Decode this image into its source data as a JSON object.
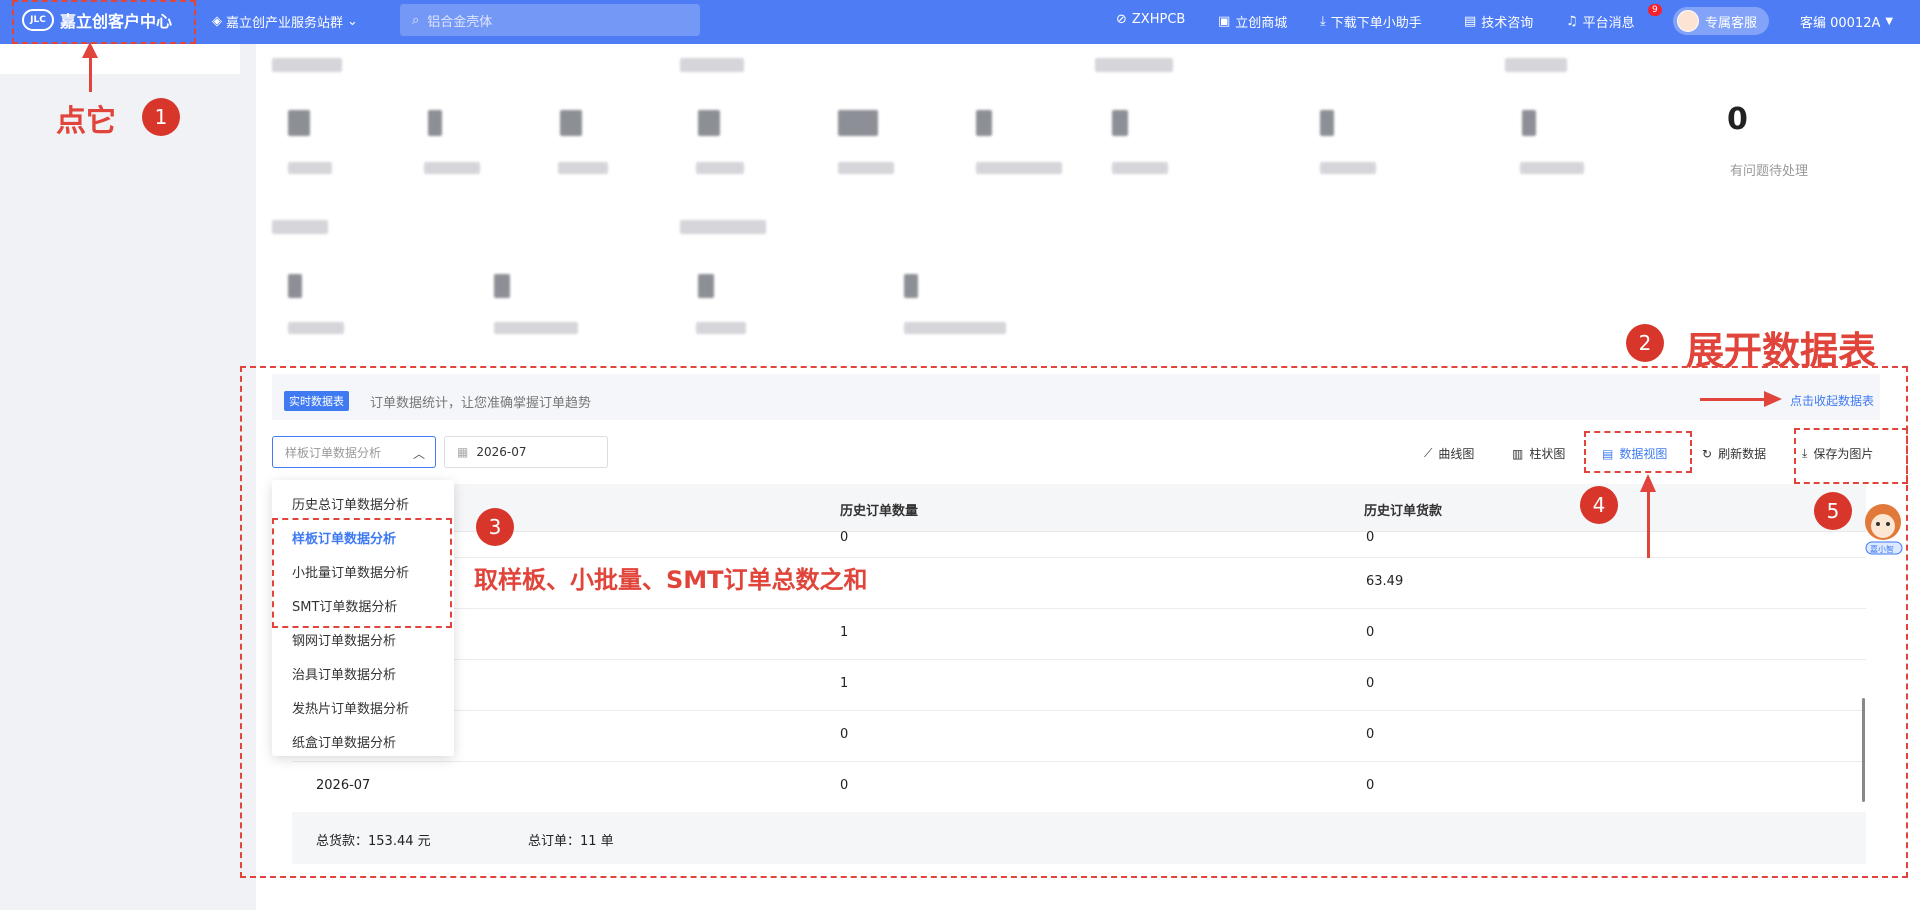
{
  "header": {
    "logo_text": "JLC",
    "brand": "嘉立创客户中心",
    "group": "嘉立创产业服务站群",
    "search_placeholder": "铝合金壳体",
    "nav": [
      "ZXHPCB",
      "立创商城",
      "下载下单小助手",
      "技术咨询",
      "平台消息"
    ],
    "message_count": "9",
    "service": "专属客服",
    "account": "客编 00012A"
  },
  "stats": {
    "problem_count": "0",
    "problem_label": "有问题待处理"
  },
  "data_table": {
    "badge": "实时数据表",
    "description": "订单数据统计，让您准确掌握订单趋势",
    "collapse_link": "点击收起数据表",
    "select_placeholder": "样板订单数据分析",
    "date_value": "2026-07",
    "toolbar": [
      "曲线图",
      "柱状图",
      "数据视图",
      "刷新数据",
      "保存为图片"
    ],
    "columns": [
      "历史订单数量",
      "历史订单货款"
    ],
    "rows": [
      {
        "month": "",
        "count": "0",
        "amount": "0"
      },
      {
        "month": "",
        "count": "",
        "amount": "63.49"
      },
      {
        "month": "",
        "count": "1",
        "amount": "0"
      },
      {
        "month": "",
        "count": "1",
        "amount": "0"
      },
      {
        "month": "",
        "count": "0",
        "amount": "0"
      },
      {
        "month": "2026-07",
        "count": "0",
        "amount": "0"
      }
    ],
    "total_amount": "总货款：153.44 元",
    "total_orders": "总订单：11 单"
  },
  "dropdown_options": [
    "历史总订单数据分析",
    "样板订单数据分析",
    "小批量订单数据分析",
    "SMT订单数据分析",
    "钢网订单数据分析",
    "治具订单数据分析",
    "发热片订单数据分析",
    "纸盒订单数据分析"
  ],
  "annotations": {
    "click_it": "点它",
    "expand_table": "展开数据表",
    "sum_note": "取样板、小批量、SMT订单总数之和",
    "steps": [
      "1",
      "2",
      "3",
      "4",
      "5"
    ]
  },
  "mascot_label": "嘉小智",
  "colors": {
    "primary": "#3f7af2",
    "topbar": "#4d7cf4",
    "annotation": "#e0443a"
  }
}
